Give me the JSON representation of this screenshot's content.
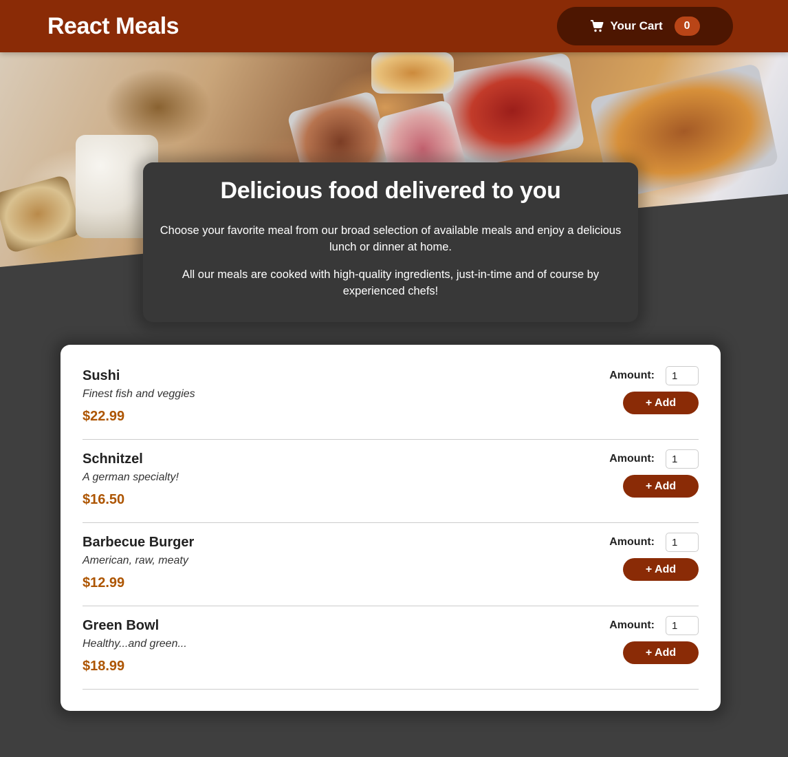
{
  "header": {
    "brand": "React Meals",
    "cart_label": "Your Cart",
    "cart_count": "0"
  },
  "summary": {
    "title": "Delicious food delivered to you",
    "paragraph1": "Choose your favorite meal from our broad selection of available meals and enjoy a delicious lunch or dinner at home.",
    "paragraph2": "All our meals are cooked with high-quality ingredients, just-in-time and of course by experienced chefs!"
  },
  "meal_form": {
    "amount_label": "Amount:",
    "add_label": "+ Add"
  },
  "meals": [
    {
      "name": "Sushi",
      "description": "Finest fish and veggies",
      "price": "$22.99",
      "amount": "1"
    },
    {
      "name": "Schnitzel",
      "description": "A german specialty!",
      "price": "$16.50",
      "amount": "1"
    },
    {
      "name": "Barbecue Burger",
      "description": "American, raw, meaty",
      "price": "$12.99",
      "amount": "1"
    },
    {
      "name": "Green Bowl",
      "description": "Healthy...and green...",
      "price": "$18.99",
      "amount": "1"
    }
  ],
  "colors": {
    "header_bg": "#8a2b06",
    "cart_button_bg": "#4d1601",
    "badge_bg": "#b94517",
    "price": "#ad5502",
    "page_bg": "#3f3f3f"
  },
  "icons": {
    "cart": "shopping-cart-icon"
  }
}
